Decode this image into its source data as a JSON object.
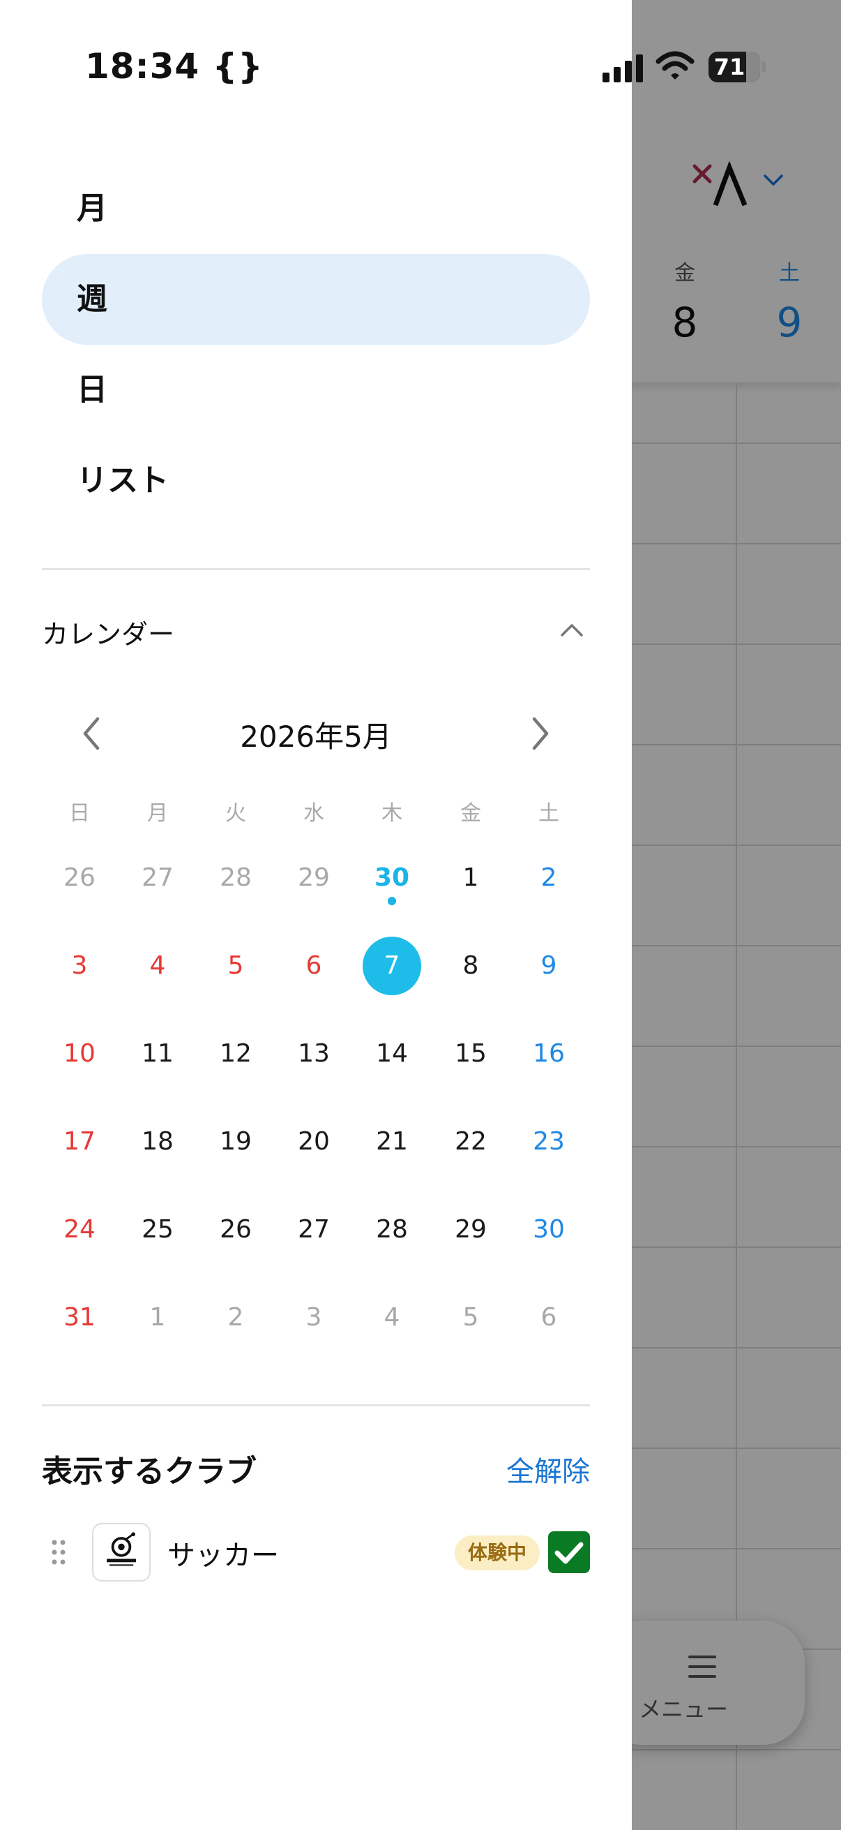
{
  "status_bar": {
    "time": "18:34 {}",
    "battery": "71"
  },
  "background": {
    "dow_labels": [
      "金",
      "土"
    ],
    "day_numbers": [
      "8",
      "9"
    ],
    "menu_label": "メニュー",
    "colors": {
      "saturday": "#1e88e5"
    }
  },
  "view_menu": {
    "items": [
      {
        "label": "月",
        "active": false
      },
      {
        "label": "週",
        "active": true
      },
      {
        "label": "日",
        "active": false
      },
      {
        "label": "リスト",
        "active": false
      }
    ]
  },
  "calendar_section": {
    "title": "カレンダー",
    "month_title": "2026年5月",
    "weekdays": [
      "日",
      "月",
      "火",
      "水",
      "木",
      "金",
      "土"
    ],
    "weeks": [
      [
        {
          "d": "26",
          "c": "gray"
        },
        {
          "d": "27",
          "c": "gray"
        },
        {
          "d": "28",
          "c": "gray"
        },
        {
          "d": "29",
          "c": "gray"
        },
        {
          "d": "30",
          "c": "today"
        },
        {
          "d": "1",
          "c": ""
        },
        {
          "d": "2",
          "c": "blue"
        }
      ],
      [
        {
          "d": "3",
          "c": "red"
        },
        {
          "d": "4",
          "c": "red"
        },
        {
          "d": "5",
          "c": "red"
        },
        {
          "d": "6",
          "c": "red"
        },
        {
          "d": "7",
          "c": "selected"
        },
        {
          "d": "8",
          "c": ""
        },
        {
          "d": "9",
          "c": "blue"
        }
      ],
      [
        {
          "d": "10",
          "c": "red"
        },
        {
          "d": "11",
          "c": ""
        },
        {
          "d": "12",
          "c": ""
        },
        {
          "d": "13",
          "c": ""
        },
        {
          "d": "14",
          "c": ""
        },
        {
          "d": "15",
          "c": ""
        },
        {
          "d": "16",
          "c": "blue"
        }
      ],
      [
        {
          "d": "17",
          "c": "red"
        },
        {
          "d": "18",
          "c": ""
        },
        {
          "d": "19",
          "c": ""
        },
        {
          "d": "20",
          "c": ""
        },
        {
          "d": "21",
          "c": ""
        },
        {
          "d": "22",
          "c": ""
        },
        {
          "d": "23",
          "c": "blue"
        }
      ],
      [
        {
          "d": "24",
          "c": "red"
        },
        {
          "d": "25",
          "c": ""
        },
        {
          "d": "26",
          "c": ""
        },
        {
          "d": "27",
          "c": ""
        },
        {
          "d": "28",
          "c": ""
        },
        {
          "d": "29",
          "c": ""
        },
        {
          "d": "30",
          "c": "blue"
        }
      ],
      [
        {
          "d": "31",
          "c": "red"
        },
        {
          "d": "1",
          "c": "gray"
        },
        {
          "d": "2",
          "c": "gray"
        },
        {
          "d": "3",
          "c": "gray"
        },
        {
          "d": "4",
          "c": "gray"
        },
        {
          "d": "5",
          "c": "gray"
        },
        {
          "d": "6",
          "c": "gray"
        }
      ]
    ],
    "colors": {
      "today": "#1ab4e6",
      "sunday_holiday": "#e53935",
      "saturday": "#1e88e5",
      "other_month": "#a8a8a8"
    }
  },
  "clubs_section": {
    "title": "表示するクラブ",
    "clear_all": "全解除",
    "clubs": [
      {
        "name": "サッカー",
        "badge": "体験中",
        "checked": true,
        "logo_icon": "breakers-logo-icon"
      }
    ]
  }
}
